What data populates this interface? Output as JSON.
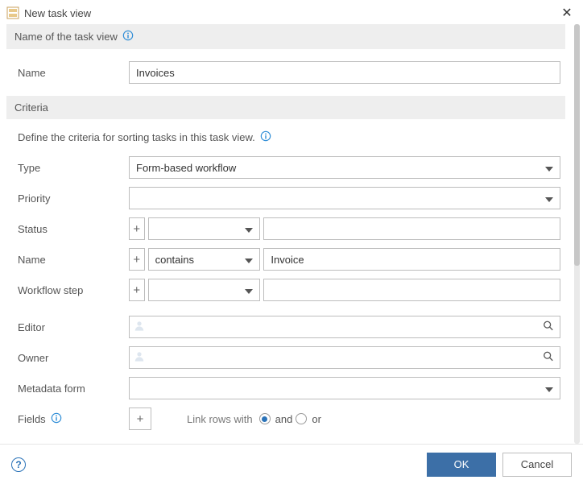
{
  "window": {
    "title": "New task view"
  },
  "sections": {
    "name_header": "Name of the task view",
    "criteria_header": "Criteria",
    "criteria_hint": "Define the criteria for sorting tasks in this task view."
  },
  "labels": {
    "name": "Name",
    "type": "Type",
    "priority": "Priority",
    "status": "Status",
    "name_crit": "Name",
    "workflow_step": "Workflow step",
    "editor": "Editor",
    "owner": "Owner",
    "metadata_form": "Metadata form",
    "fields": "Fields",
    "link_rows_with": "Link rows with",
    "and": "and",
    "or": "or"
  },
  "values": {
    "name": "Invoices",
    "type": "Form-based workflow",
    "priority": "",
    "status_op": "",
    "status_val": "",
    "name_op": "contains",
    "name_val": "Invoice",
    "wf_op": "",
    "wf_val": "",
    "editor": "",
    "owner": "",
    "metadata_form": "",
    "link_mode": "and"
  },
  "buttons": {
    "plus": "+",
    "ok": "OK",
    "cancel": "Cancel",
    "close": "✕",
    "help": "?"
  }
}
